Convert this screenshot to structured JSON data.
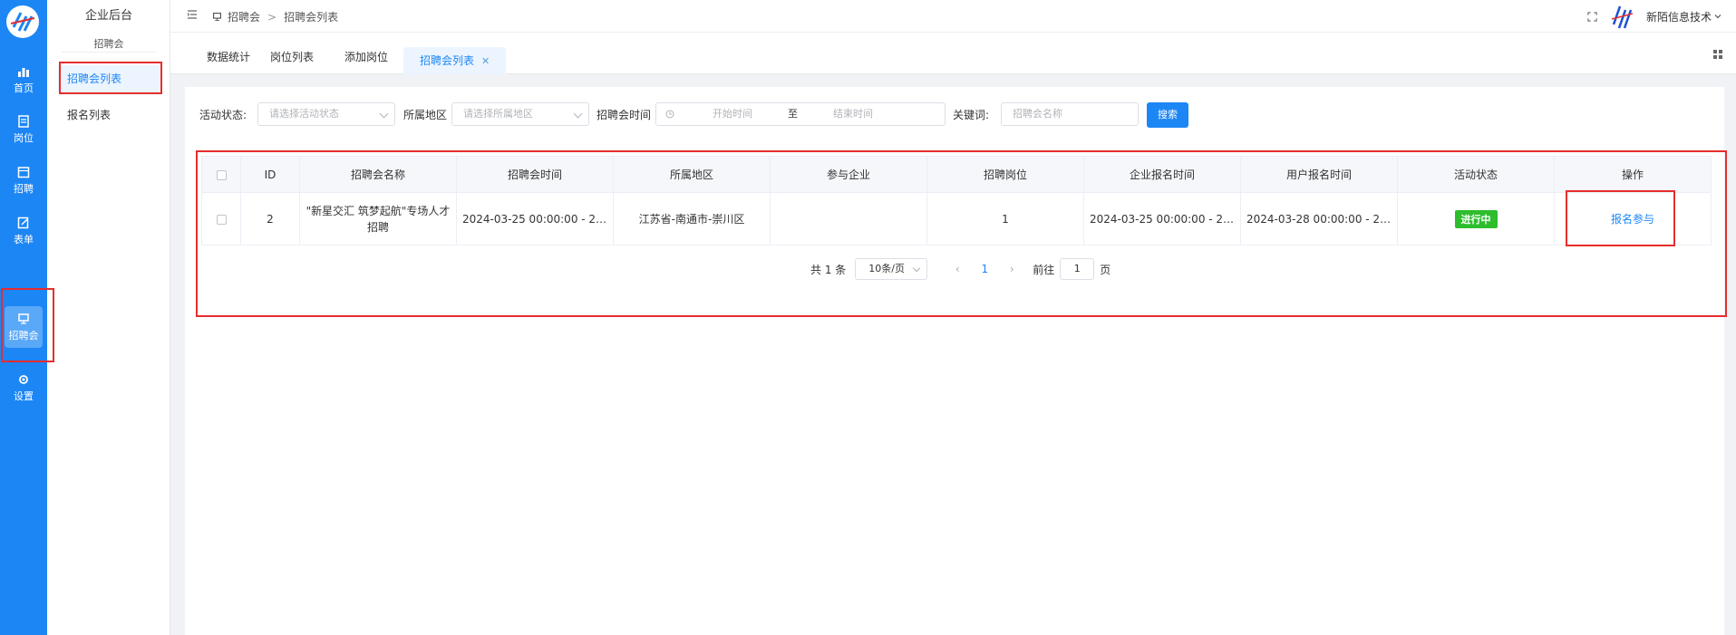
{
  "sidebar": {
    "items": [
      {
        "label": "首页"
      },
      {
        "label": "岗位"
      },
      {
        "label": "招聘"
      },
      {
        "label": "表单"
      },
      {
        "label": "招聘会"
      },
      {
        "label": "设置"
      }
    ]
  },
  "subbar": {
    "title": "企业后台",
    "group": "招聘会",
    "items": [
      {
        "label": "招聘会列表"
      },
      {
        "label": "报名列表"
      }
    ]
  },
  "header": {
    "breadcrumb": [
      "招聘会",
      "招聘会列表"
    ],
    "company": "新陌信息技术"
  },
  "tabs": [
    {
      "label": "数据统计"
    },
    {
      "label": "岗位列表"
    },
    {
      "label": "添加岗位"
    },
    {
      "label": "招聘会列表"
    }
  ],
  "filters": {
    "status_label": "活动状态:",
    "status_placeholder": "请选择活动状态",
    "region_label": "所属地区",
    "region_placeholder": "请选择所属地区",
    "time_label": "招聘会时间",
    "start_placeholder": "开始时间",
    "range_sep": "至",
    "end_placeholder": "结束时间",
    "keyword_label": "关键词:",
    "keyword_placeholder": "招聘会名称",
    "search_label": "搜索"
  },
  "table": {
    "columns": [
      "ID",
      "招聘会名称",
      "招聘会时间",
      "所属地区",
      "参与企业",
      "招聘岗位",
      "企业报名时间",
      "用户报名时间",
      "活动状态",
      "操作"
    ],
    "rows": [
      {
        "id": "2",
        "name": "\"新星交汇 筑梦起航\"专场人才招聘",
        "time": "2024-03-25 00:00:00 - 2024-...",
        "region": "江苏省-南通市-崇川区",
        "companies": "",
        "positions": "1",
        "company_signup": "2024-03-25 00:00:00 - 2024-...",
        "user_signup": "2024-03-28 00:00:00 - 2024-...",
        "status": "进行中",
        "action": "报名参与"
      }
    ]
  },
  "pagination": {
    "total": "共 1 条",
    "page_size": "10条/页",
    "current": "1",
    "goto_label": "前往",
    "goto_value": "1",
    "page_suffix": "页"
  },
  "colors": {
    "primary": "#1c86f5",
    "status_green": "#2dbd2d",
    "annotation_red": "#e62d2d"
  }
}
